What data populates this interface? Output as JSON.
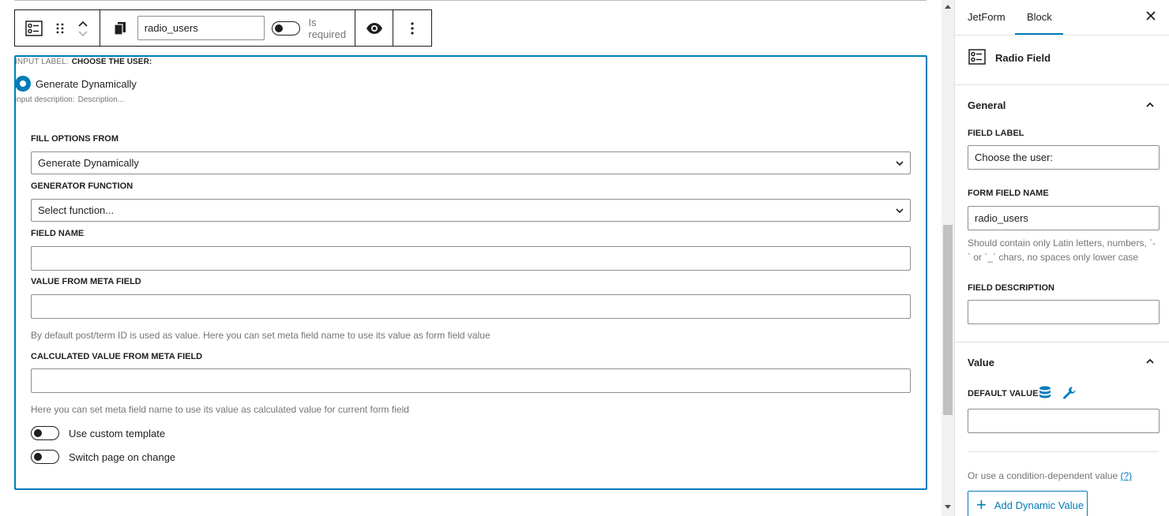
{
  "toolbar": {
    "name_value": "radio_users",
    "required_label": "Is required"
  },
  "block": {
    "input_label_prefix": "INPUT LABEL:",
    "input_label_value": "CHOOSE THE USER:",
    "radio_option": "Generate Dynamically",
    "input_desc_prefix": "input description:",
    "input_desc_placeholder": "Description..."
  },
  "settings": {
    "fill_options_label": "FILL OPTIONS FROM",
    "fill_options_value": "Generate Dynamically",
    "generator_label": "GENERATOR FUNCTION",
    "generator_value": "Select function...",
    "field_name_label": "FIELD NAME",
    "value_meta_label": "VALUE FROM META FIELD",
    "value_meta_help": "By default post/term ID is used as value. Here you can set meta field name to use its value as form field value",
    "calc_meta_label": "CALCULATED VALUE FROM META FIELD",
    "calc_meta_help": "Here you can set meta field name to use its value as calculated value for current form field",
    "custom_template_label": "Use custom template",
    "switch_page_label": "Switch page on change"
  },
  "sidebar": {
    "tab_jetform": "JetForm",
    "tab_block": "Block",
    "block_title": "Radio Field",
    "general_heading": "General",
    "field_label_label": "FIELD LABEL",
    "field_label_value": "Choose the user:",
    "form_field_name_label": "FORM FIELD NAME",
    "form_field_name_value": "radio_users",
    "form_field_name_help": "Should contain only Latin letters, numbers, `-` or `_` chars, no spaces only lower case",
    "field_desc_label": "FIELD DESCRIPTION",
    "value_heading": "Value",
    "default_value_label": "DEFAULT VALUE",
    "condition_text": "Or use a condition-dependent value",
    "condition_link": "(?)",
    "add_dynamic_label": "Add Dynamic Value"
  },
  "colors": {
    "accent": "#007cba",
    "muted_text": "#757575",
    "border": "#8c8f94"
  },
  "icons": [
    "radio-field-icon",
    "drag-handle-icon",
    "chevron-up-icon",
    "chevron-down-icon",
    "copy-icon",
    "eye-icon",
    "more-vertical-icon",
    "close-icon",
    "database-icon",
    "wrench-icon",
    "plus-icon"
  ]
}
